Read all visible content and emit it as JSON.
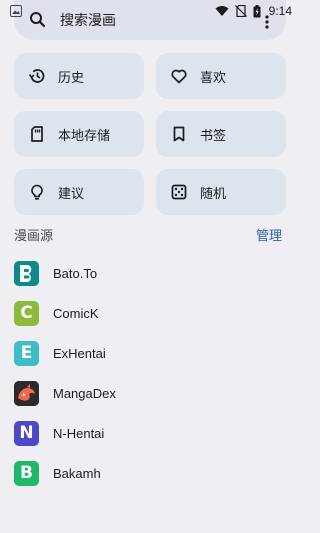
{
  "status_bar": {
    "time": "9:14",
    "icons": [
      "image-icon",
      "wifi-icon",
      "no-sim-icon",
      "battery-icon"
    ]
  },
  "search": {
    "placeholder": "搜索漫画"
  },
  "quick_actions": [
    {
      "label": "历史",
      "icon": "history-icon"
    },
    {
      "label": "喜欢",
      "icon": "heart-icon"
    },
    {
      "label": "本地存储",
      "icon": "sd-card-icon"
    },
    {
      "label": "书签",
      "icon": "bookmark-icon"
    },
    {
      "label": "建议",
      "icon": "lightbulb-icon"
    },
    {
      "label": "随机",
      "icon": "dice-icon"
    }
  ],
  "sources_section": {
    "title": "漫画源",
    "action_label": "管理"
  },
  "sources": [
    {
      "name": "Bato.To",
      "logo_letter": "B",
      "logo_color": "#0f8a8c"
    },
    {
      "name": "ComicK",
      "logo_letter": "C",
      "logo_color": "#8cba3a"
    },
    {
      "name": "ExHentai",
      "logo_letter": "E",
      "logo_color": "#3fbcc4"
    },
    {
      "name": "MangaDex",
      "logo_letter": "",
      "logo_color": "#2b2b2b"
    },
    {
      "name": "N-Hentai",
      "logo_letter": "N",
      "logo_color": "#4e48c6"
    },
    {
      "name": "Bakamh",
      "logo_letter": "B",
      "logo_color": "#1fb86a"
    }
  ],
  "colors": {
    "background": "#eeeef3",
    "card": "#dde4ee",
    "accent": "#2a5fa8"
  }
}
